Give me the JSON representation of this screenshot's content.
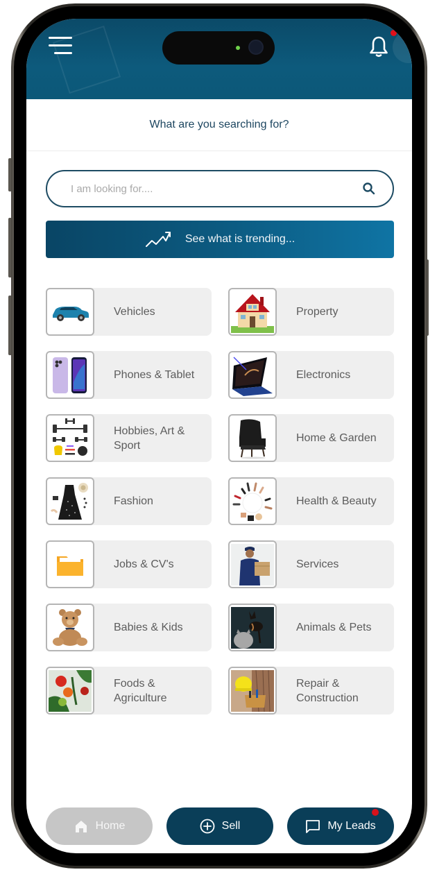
{
  "header": {
    "menu_icon": "hamburger-menu-icon",
    "notification_icon": "bell-icon",
    "notification_dot_color": "#e0101a",
    "brand_color": "#0d5a7c"
  },
  "subtitle": "What are you searching for?",
  "search": {
    "placeholder": "I am looking for....",
    "value": "",
    "icon": "search-icon"
  },
  "trending": {
    "label": "See what is trending...",
    "icon": "trending-up-icon"
  },
  "categories": [
    {
      "label": "Vehicles",
      "image": "blue-suv-car"
    },
    {
      "label": "Property",
      "image": "house"
    },
    {
      "label": "Phones & Tablet",
      "image": "smartphones"
    },
    {
      "label": "Electronics",
      "image": "convertible-laptop"
    },
    {
      "label": "Hobbies, Art & Sport",
      "image": "gym-weights"
    },
    {
      "label": "Home & Garden",
      "image": "armchair"
    },
    {
      "label": "Fashion",
      "image": "dress-accessories"
    },
    {
      "label": "Health & Beauty",
      "image": "cosmetics-circle"
    },
    {
      "label": "Jobs & CV's",
      "image": "folder"
    },
    {
      "label": "Services",
      "image": "delivery-man-box"
    },
    {
      "label": "Babies & Kids",
      "image": "teddy-bear"
    },
    {
      "label": "Animals & Pets",
      "image": "dog-and-cat"
    },
    {
      "label": "Foods & Agriculture",
      "image": "tomatoes"
    },
    {
      "label": "Repair & Construction",
      "image": "hard-hat-tool-belt"
    }
  ],
  "bottom_nav": {
    "home": {
      "label": "Home",
      "icon": "home-icon"
    },
    "sell": {
      "label": "Sell",
      "icon": "plus-circle-icon"
    },
    "leads": {
      "label": "My Leads",
      "icon": "chat-bubble-icon",
      "has_notification": true
    }
  }
}
